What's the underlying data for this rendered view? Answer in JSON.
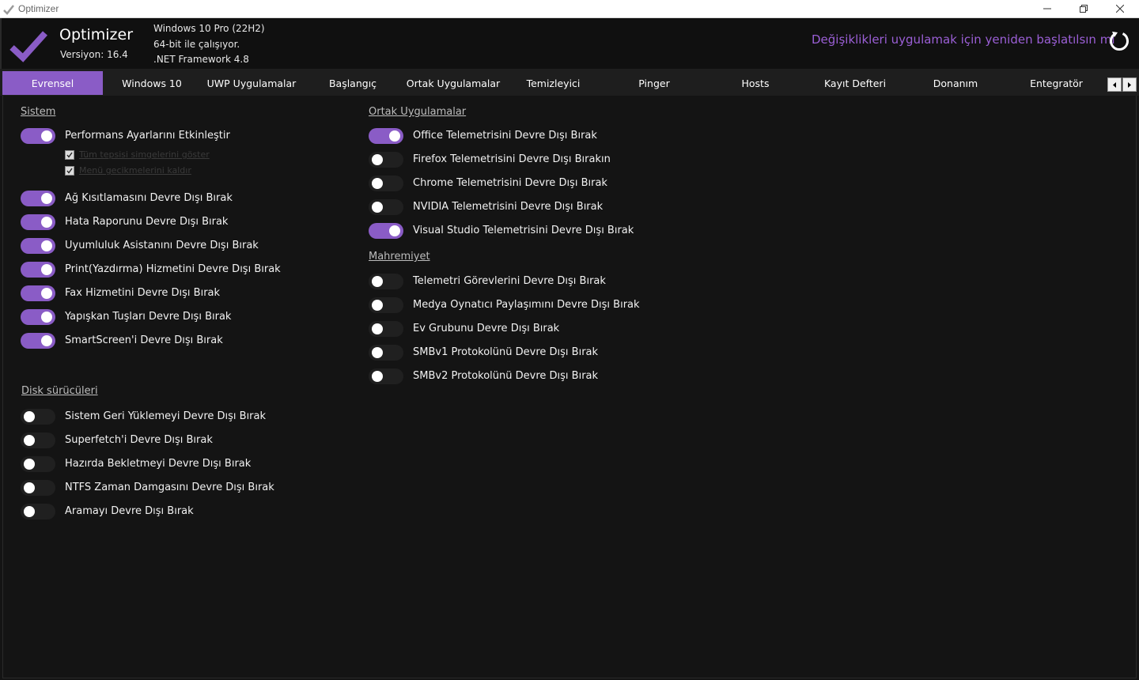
{
  "window": {
    "title": "Optimizer",
    "minimize_icon": "minimize-icon",
    "maximize_icon": "restore-icon",
    "close_icon": "close-icon"
  },
  "header": {
    "app_name": "Optimizer",
    "version": "Versiyon: 16.4",
    "sysinfo": [
      "Windows 10 Pro (22H2)",
      "64-bit ile çalışıyor.",
      ".NET Framework 4.8"
    ],
    "restart_prompt": "Değişiklikleri uygulamak için yeniden başlatılsın mı",
    "accent_color": "#8a5cc6"
  },
  "tabs": [
    "Evrensel",
    "Windows 10",
    "UWP Uygulamalar",
    "Başlangıç",
    "Ortak Uygulamalar",
    "Temizleyici",
    "Pinger",
    "Hosts",
    "Kayıt Defteri",
    "Donanım",
    "Entegratör"
  ],
  "active_tab": "Evrensel",
  "sections": {
    "sistem": {
      "title": "Sistem",
      "items": [
        {
          "label": "Performans Ayarlarını Etkinleştir",
          "on": true
        },
        {
          "label": "Ağ Kısıtlamasını Devre Dışı Bırak",
          "on": true
        },
        {
          "label": "Hata Raporunu Devre Dışı Bırak",
          "on": true
        },
        {
          "label": "Uyumluluk Asistanını Devre Dışı Bırak",
          "on": true
        },
        {
          "label": "Print(Yazdırma) Hizmetini Devre Dışı Bırak",
          "on": true
        },
        {
          "label": "Fax Hizmetini Devre Dışı Bırak",
          "on": true
        },
        {
          "label": "Yapışkan Tuşları Devre Dışı Bırak",
          "on": true
        },
        {
          "label": "SmartScreen'i Devre Dışı Bırak",
          "on": true
        }
      ],
      "sub_options": [
        {
          "label": "Tüm tepsisi simgelerini göster",
          "checked": true
        },
        {
          "label": "Menü gecikmelerini kaldır",
          "checked": true
        }
      ]
    },
    "disk": {
      "title": "Disk sürücüleri",
      "items": [
        {
          "label": "Sistem Geri Yüklemeyi Devre Dışı Bırak",
          "on": false
        },
        {
          "label": "Superfetch'i Devre Dışı Bırak",
          "on": false
        },
        {
          "label": "Hazırda Bekletmeyi Devre Dışı Bırak",
          "on": false
        },
        {
          "label": "NTFS Zaman Damgasını Devre Dışı Bırak",
          "on": false
        },
        {
          "label": "Aramayı Devre Dışı Bırak",
          "on": false
        }
      ]
    },
    "ortak": {
      "title": "Ortak Uygulamalar",
      "items": [
        {
          "label": "Office Telemetrisini Devre Dışı Bırak",
          "on": true
        },
        {
          "label": "Firefox Telemetrisini Devre Dışı Bırakın",
          "on": false
        },
        {
          "label": "Chrome Telemetrisini Devre Dışı Bırak",
          "on": false
        },
        {
          "label": "NVIDIA Telemetrisini Devre Dışı Bırak",
          "on": false
        },
        {
          "label": "Visual Studio Telemetrisini Devre Dışı Bırak",
          "on": true
        }
      ]
    },
    "mahremiyet": {
      "title": "Mahremiyet",
      "items": [
        {
          "label": "Telemetri Görevlerini Devre Dışı Bırak",
          "on": false
        },
        {
          "label": "Medya Oynatıcı Paylaşımını Devre Dışı Bırak",
          "on": false
        },
        {
          "label": "Ev Grubunu Devre Dışı Bırak",
          "on": false
        },
        {
          "label": "SMBv1 Protokolünü Devre Dışı Bırak",
          "on": false
        },
        {
          "label": "SMBv2 Protokolünü Devre Dışı Bırak",
          "on": false
        }
      ]
    }
  }
}
